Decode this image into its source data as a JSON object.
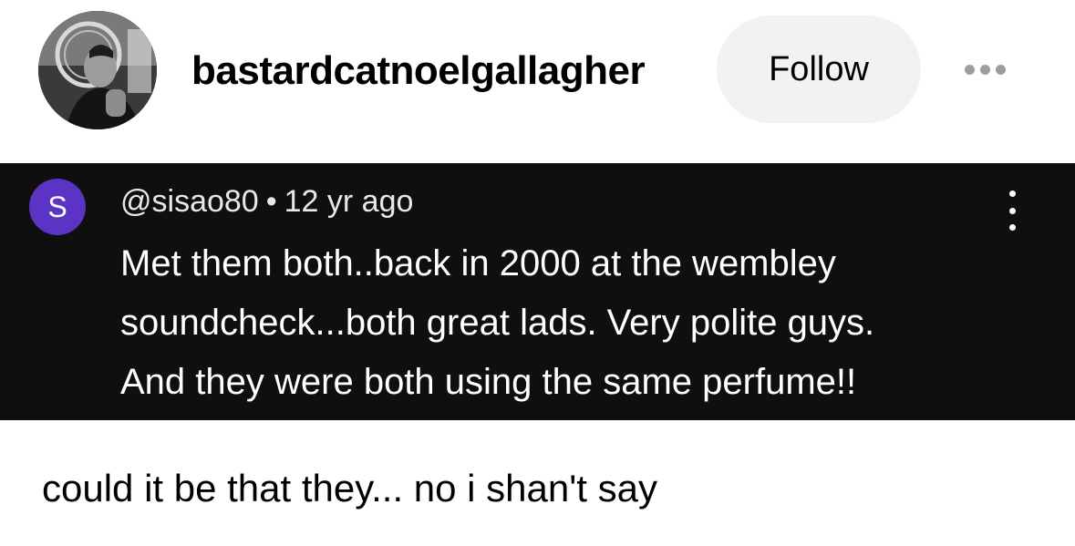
{
  "post": {
    "username": "bastardcatnoelgallagher",
    "follow_label": "Follow",
    "more_icon": "more-horizontal-icon"
  },
  "comment": {
    "avatar_letter": "S",
    "handle": "@sisao80",
    "separator": "•",
    "time_ago": "12 yr ago",
    "lines": [
      "Met them both..back in 2000 at the wembley",
      "soundcheck...both great lads. Very polite guys.",
      "And they were both using the same perfume!!"
    ],
    "menu_icon": "more-vertical-icon",
    "avatar_color": "#5c34c5",
    "background_color": "#0f0f0f"
  },
  "caption": "could it be that they... no i shan't say"
}
